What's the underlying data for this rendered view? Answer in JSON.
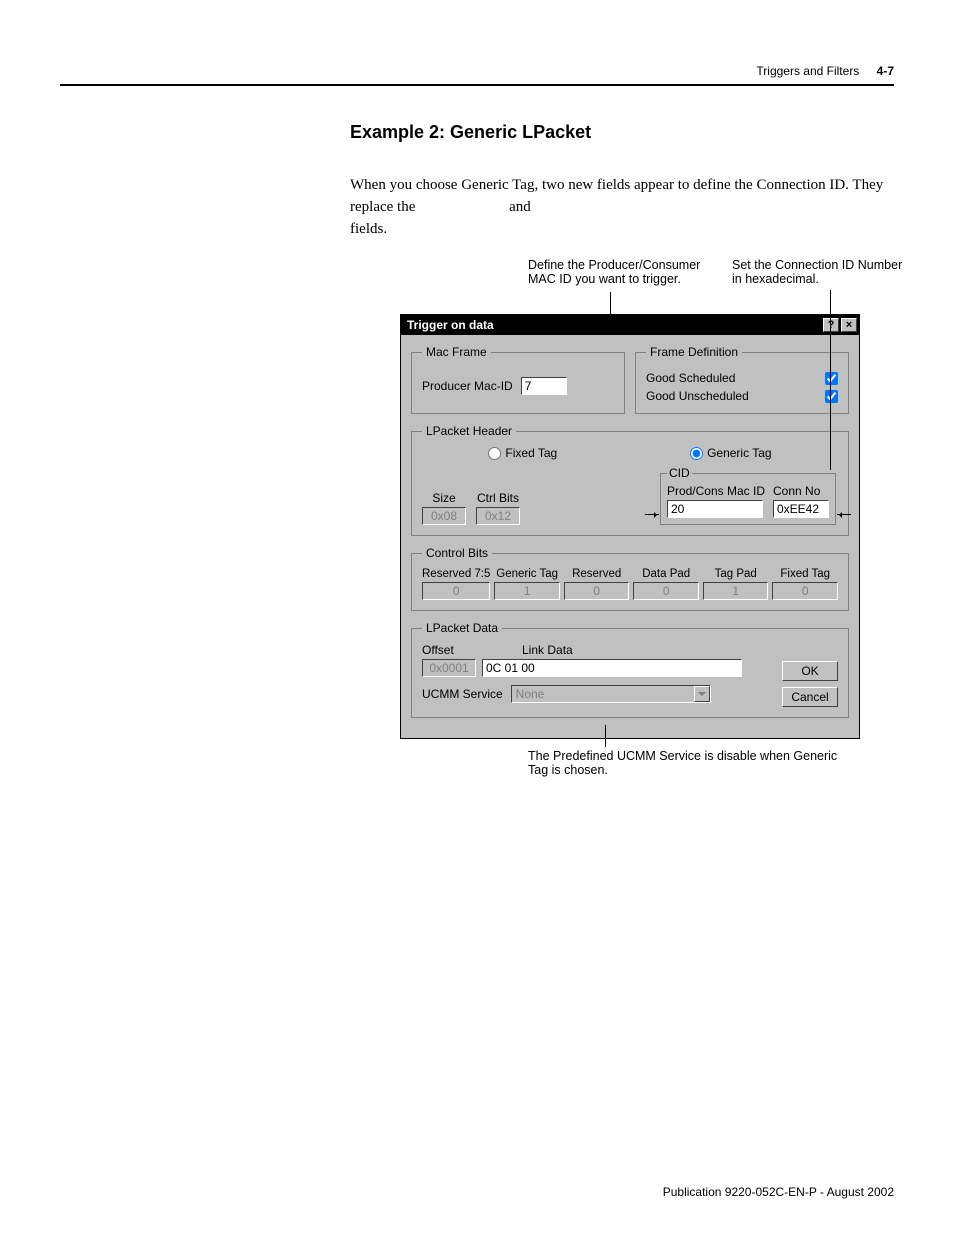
{
  "header": {
    "section": "Triggers and Filters",
    "page": "4-7"
  },
  "heading": "Example 2: Generic LPacket",
  "intro_full": "When you choose Generic Tag, two new fields appear to define the Connection ID. They replace the            and            fields.",
  "intro": {
    "line1_a": "When you choose Generic Tag, two new fields appear to define the ",
    "line2_a": "Connection ID. They replace the",
    "line2_and": "and",
    "line3": "fields."
  },
  "callouts": {
    "top_left": "Define the Producer/Consumer MAC ID you want to trigger.",
    "top_right": "Set the Connection ID Number in hexadecimal.",
    "bottom": "The Predefined UCMM Service is disable when Generic Tag is chosen."
  },
  "dialog": {
    "title": "Trigger on data",
    "help_glyph": "?",
    "close_glyph": "×",
    "groups": {
      "mac_frame": {
        "legend": "Mac Frame",
        "producer_label": "Producer Mac-ID",
        "producer_value": "7"
      },
      "frame_def": {
        "legend": "Frame Definition",
        "good_scheduled": "Good Scheduled",
        "good_unscheduled": "Good Unscheduled",
        "gs_checked": true,
        "gu_checked": true
      },
      "lpacket_header": {
        "legend": "LPacket Header",
        "fixed_tag": "Fixed Tag",
        "generic_tag": "Generic Tag",
        "size_label": "Size",
        "size_value": "0x08",
        "ctrl_label": "Ctrl Bits",
        "ctrl_value": "0x12",
        "cid_legend": "CID",
        "pc_label": "Prod/Cons Mac ID",
        "pc_value": "20",
        "conn_label": "Conn No",
        "conn_value": "0xEE42"
      },
      "control_bits": {
        "legend": "Control Bits",
        "cols": [
          {
            "label": "Reserved 7:5",
            "value": "0"
          },
          {
            "label": "Generic Tag",
            "value": "1"
          },
          {
            "label": "Reserved",
            "value": "0"
          },
          {
            "label": "Data Pad",
            "value": "0"
          },
          {
            "label": "Tag Pad",
            "value": "1"
          },
          {
            "label": "Fixed Tag",
            "value": "0"
          }
        ]
      },
      "lpacket_data": {
        "legend": "LPacket Data",
        "offset_label": "Offset",
        "linkdata_label": "Link Data",
        "offset_value": "0x0001",
        "linkdata_value": "0C 01 00",
        "ucmm_label": "UCMM Service",
        "ucmm_value": "None"
      }
    },
    "buttons": {
      "ok": "OK",
      "cancel": "Cancel"
    }
  },
  "footer": "Publication 9220-052C-EN-P - August 2002"
}
